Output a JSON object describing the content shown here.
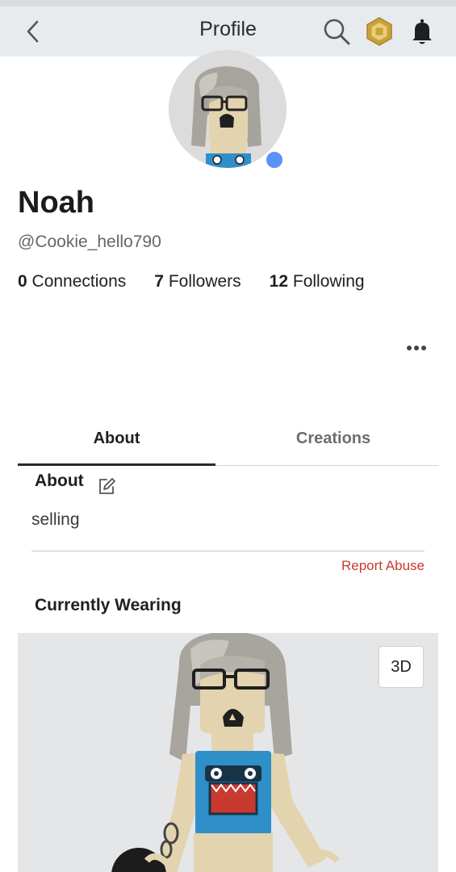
{
  "header": {
    "title": "Profile",
    "icons": [
      "back-arrow-icon",
      "search-icon",
      "robux-icon",
      "bell-icon"
    ]
  },
  "profile": {
    "display_name": "Noah",
    "username": "@Cookie_hello790",
    "online_status_color": "#5b93f5",
    "stats": {
      "connections_count": "0",
      "connections_label": "Connections",
      "followers_count": "7",
      "followers_label": "Followers",
      "following_count": "12",
      "following_label": "Following"
    }
  },
  "tabs": [
    {
      "label": "About",
      "selected": true
    },
    {
      "label": "Creations",
      "selected": false
    }
  ],
  "about": {
    "heading": "About",
    "text": "selling",
    "report_label": "Report Abuse"
  },
  "wearing": {
    "heading": "Currently Wearing",
    "view_toggle_label": "3D"
  },
  "colors": {
    "header_bg": "#e8ebee",
    "report_link": "#c93a2e",
    "robux_gold": "#c9a13b"
  }
}
